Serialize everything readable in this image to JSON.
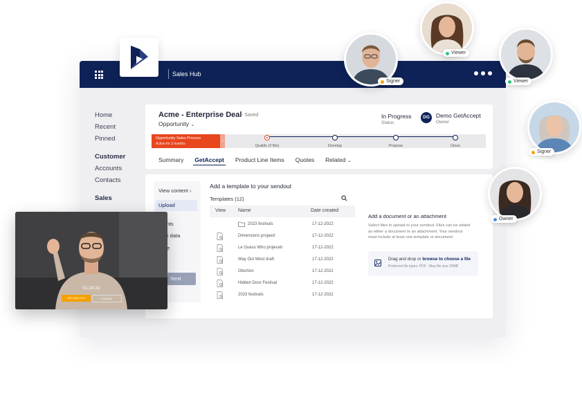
{
  "topbar": {
    "app_name": "Sales Hub"
  },
  "nav": {
    "items": [
      "Home",
      "Recent",
      "Pinned"
    ],
    "section_customer": "Customer",
    "customer_items": [
      "Accounts",
      "Contacts"
    ],
    "section_sales": "Sales"
  },
  "deal": {
    "title": "Acme - Enterprise Deal",
    "saved": "- Saved",
    "type": "Opportunity",
    "status_value": "In Progress",
    "status_label": "Status",
    "owner_initials": "DG",
    "owner_name": "Demo GetAccept",
    "owner_label": "Owner"
  },
  "process": {
    "title": "Opportunity Sales Process",
    "subtitle": "Active for 3 months",
    "stages": [
      "Qualify (3 Mo)",
      "Develop",
      "Propose",
      "Close"
    ]
  },
  "tabs": [
    "Summary",
    "GetAccept",
    "Product Line Items",
    "Quotes",
    "Related"
  ],
  "steps": {
    "view_content": "View content",
    "upload": "Upload",
    "recipients": "ipients",
    "update_data": "date data",
    "message": "sage",
    "send": "d",
    "next": "Next"
  },
  "templates": {
    "heading": "Add a template to your sendout",
    "count": "Templates (12)",
    "columns": [
      "View",
      "Name",
      "Date created"
    ],
    "rows": [
      {
        "name": "2023 festivals",
        "date": "17-12-2022"
      },
      {
        "name": "Dimensions projaed",
        "date": "17-12-2022"
      },
      {
        "name": "Le Guess Who projeceti",
        "date": "17-12-2022"
      },
      {
        "name": "Way Out West draft",
        "date": "17-12-2022"
      },
      {
        "name": "Obsrtion",
        "date": "17-12-2022"
      },
      {
        "name": "Hidden Door Festival",
        "date": "17-12-2022"
      },
      {
        "name": "2023 festivals",
        "date": "17-12-2022"
      }
    ]
  },
  "attachment": {
    "title": "Add a document or an attachment",
    "description": "Select files to upload to your sendout. Files can be added as either a document or an attachment. Your sendout must include at least one template or document.",
    "drop_prefix": "Drag and drop or",
    "drop_link": "browse to choose a file",
    "file_types": "Preferred file types: PDF - Max file size 25MB"
  },
  "video": {
    "timer": "01:24:32",
    "upload_label": "UPLOAD FILE",
    "cancel_label": "CANCEL"
  },
  "participants": [
    {
      "role": "Signer",
      "color": "#f5a100"
    },
    {
      "role": "Viewer",
      "color": "#2ec27e"
    },
    {
      "role": "Viewer",
      "color": "#2ec27e"
    },
    {
      "role": "Signer",
      "color": "#f5a100"
    },
    {
      "role": "Owner",
      "color": "#4a90d9"
    }
  ]
}
